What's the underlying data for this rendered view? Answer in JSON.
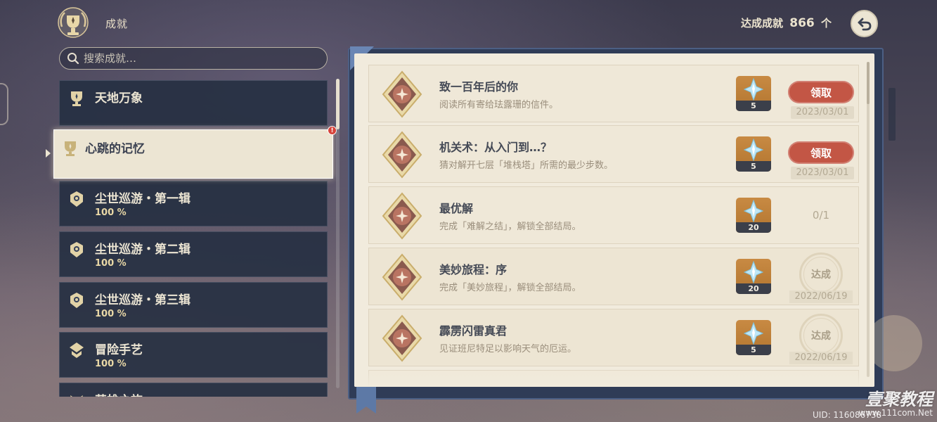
{
  "header": {
    "title": "成就",
    "total_prefix": "达成成就",
    "total_count": "866",
    "total_suffix": "个",
    "back_icon": "back-arrow-icon"
  },
  "search": {
    "placeholder": "搜索成就…"
  },
  "categories": [
    {
      "name": "天地万象",
      "progress": ""
    },
    {
      "name": "心跳的记忆",
      "progress": "",
      "badge": "!"
    },
    {
      "name": "尘世巡游・第一辑",
      "progress": "100 %"
    },
    {
      "name": "尘世巡游・第二辑",
      "progress": "100 %"
    },
    {
      "name": "尘世巡游・第三辑",
      "progress": "100 %"
    },
    {
      "name": "冒险手艺",
      "progress": "100 %"
    },
    {
      "name": "英雄之旅",
      "progress": ""
    }
  ],
  "achievements": [
    {
      "title": "致一百年后的你",
      "desc": "阅读所有寄给珐露珊的信件。",
      "reward": "5",
      "action": "领取",
      "date": "2023/03/01"
    },
    {
      "title": "机关术：从入门到…？",
      "desc": "猜对解开七层「堆栈塔」所需的最少步数。",
      "reward": "5",
      "action": "领取",
      "date": "2023/03/01"
    },
    {
      "title": "最优解",
      "desc": "完成「难解之结」，解锁全部结局。",
      "reward": "20",
      "progress": "0/1"
    },
    {
      "title": "美妙旅程：序",
      "desc": "完成「美妙旅程」，解锁全部结局。",
      "reward": "20",
      "status": "达成",
      "date": "2022/06/19"
    },
    {
      "title": "霹雳闪雷真君",
      "desc": "见证班尼特足以影响天气的厄运。",
      "reward": "5",
      "status": "达成",
      "date": "2022/06/19"
    }
  ],
  "watermark": {
    "text": "壹聚教程",
    "url": "www.111com.Net"
  },
  "uid": "UID: 116086738",
  "colors": {
    "claim": "#c35645",
    "panel": "#f1ebdd",
    "category_bg": "#263042",
    "reward_bg": "#c88a43"
  }
}
